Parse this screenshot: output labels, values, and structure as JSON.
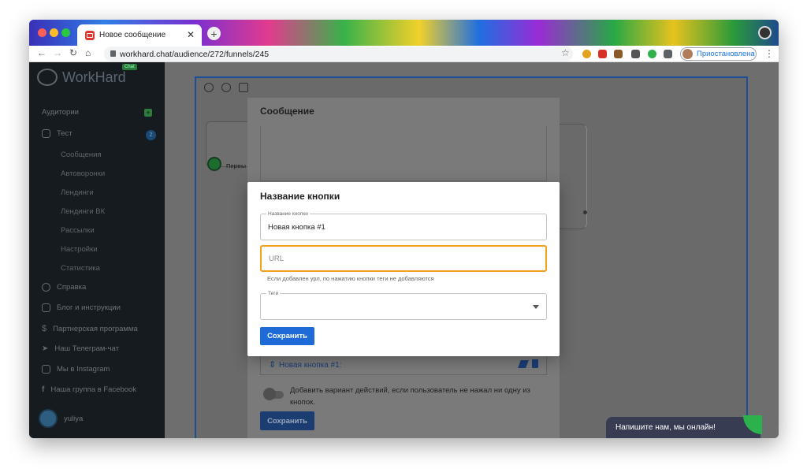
{
  "browser": {
    "tab_title": "Новое сообщение",
    "tab_close": "✕",
    "new_tab": "+",
    "url": "workhard.chat/audience/272/funnels/245",
    "profile_status": "Приостановлена"
  },
  "sidebar": {
    "logo_text": "WorkHard",
    "logo_badge": "Chat",
    "audiences": "Аудитории",
    "project": "Тест",
    "project_count": "2",
    "sub_items": [
      "Сообщения",
      "Автоворонки",
      "Лендинги",
      "Лендинги ВК",
      "Рассылки",
      "Настройки",
      "Статистика"
    ],
    "items": [
      "Справка",
      "Блог и инструкции",
      "Партнерская программа",
      "Наш Телеграм-чат",
      "Мы в Instagram",
      "Наша группа в Facebook"
    ],
    "user_name": "yuliya"
  },
  "canvas": {
    "first_node_label": "Первы"
  },
  "message_modal": {
    "title": "Сообщение",
    "button_row_label": "Новая кнопка #1:",
    "toggle_text": "Добавить вариант действий, если пользователь не нажал ни одну из кнопок.",
    "save_label": "Сохранить"
  },
  "dialog": {
    "title": "Название кнопки",
    "name_field_label": "Название кнопки",
    "name_field_value": "Новая кнопка #1",
    "url_placeholder": "URL",
    "url_hint": "Если добавлен урл, по нажатию кнопки теги не добавляются",
    "tags_label": "Теги",
    "save_label": "Сохранить"
  },
  "chat_widget": {
    "text": "Напишите нам, мы онлайн!"
  },
  "colors": {
    "primary": "#1e6ad6",
    "focus_border": "#f0a21c",
    "chat_bg": "#373c52"
  }
}
